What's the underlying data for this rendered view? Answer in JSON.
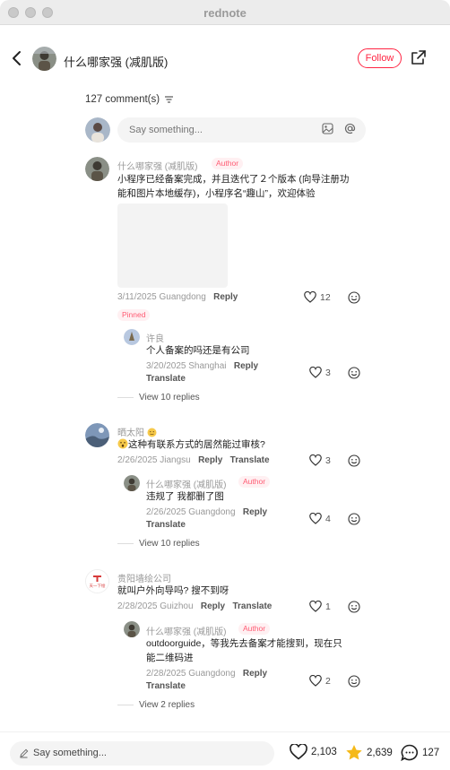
{
  "window": {
    "title": "rednote"
  },
  "header": {
    "author_name": "什么哪家强 (减肌版)",
    "follow_label": "Follow"
  },
  "comments_count": "127 comment(s)",
  "input": {
    "placeholder": "Say something..."
  },
  "comments": [
    {
      "name": "什么哪家强 (减肌版)",
      "badge": "Author",
      "text_lines": [
        "小程序已经备案完成，并且迭代了２个版本 (向导注册功",
        "能和图片本地缓存)，小程序名“趣山”，欢迎体验"
      ],
      "date_loc": "3/11/2025 Guangdong",
      "reply": "Reply",
      "likes": "12",
      "pinned": "Pinned",
      "replies": [
        {
          "name": "许良",
          "text": "个人备案的吗还是有公司",
          "date_loc": "3/20/2025 Shanghai",
          "reply": "Reply",
          "translate": "Translate",
          "likes": "3"
        }
      ],
      "view_replies": "View 10 replies"
    },
    {
      "name": "晒太阳",
      "text": "这种有联系方式的居然能过审核?",
      "date_loc": "2/26/2025 Jiangsu",
      "reply": "Reply",
      "translate": "Translate",
      "likes": "3",
      "replies": [
        {
          "name": "什么哪家强 (减肌版)",
          "badge": "Author",
          "text": "违规了 我都删了图",
          "date_loc": "2/26/2025 Guangdong",
          "reply": "Reply",
          "translate": "Translate",
          "likes": "4"
        }
      ],
      "view_replies": "View 10 replies"
    },
    {
      "name": "贵阳墙绘公司",
      "avatar_text": "天一下绘",
      "text": "就叫户外向导吗? 搜不到呀",
      "date_loc": "2/28/2025 Guizhou",
      "reply": "Reply",
      "translate": "Translate",
      "likes": "1",
      "replies": [
        {
          "name": "什么哪家强 (减肌版)",
          "badge": "Author",
          "text_lines": [
            "outdoorguide，等我先去备案才能搜到，现在只",
            "能二维码进"
          ],
          "date_loc": "2/28/2025 Guangdong",
          "reply": "Reply",
          "translate": "Translate",
          "likes": "2"
        }
      ],
      "view_replies": "View 2 replies"
    }
  ],
  "bottom": {
    "placeholder": "Say something...",
    "likes": "2,103",
    "collects": "2,639",
    "comments": "127"
  },
  "colors": {
    "accent": "#ff2442",
    "star": "#f5b919"
  }
}
